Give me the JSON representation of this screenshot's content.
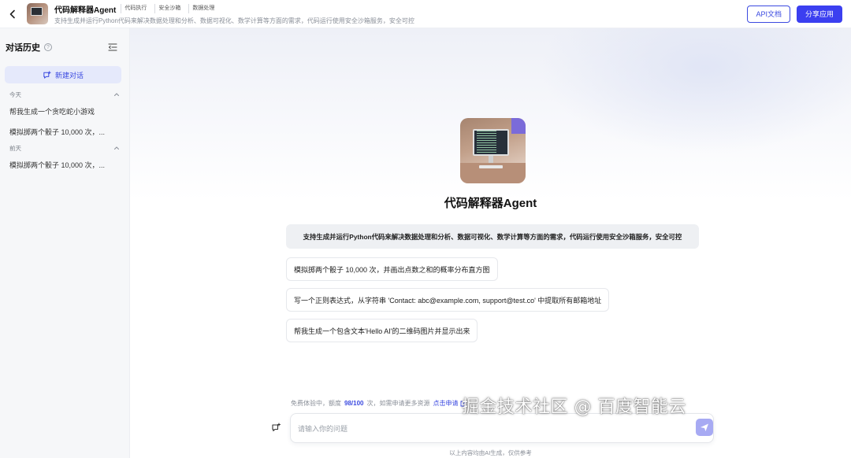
{
  "header": {
    "app_name": "代码解释器Agent",
    "tags": [
      "代码执行",
      "安全沙箱",
      "数据处理"
    ],
    "description": "支持生成并运行Python代码来解决数据处理和分析、数据可视化、数学计算等方面的需求，代码运行使用安全沙箱服务，安全可控",
    "api_doc_label": "API文档",
    "share_label": "分享应用"
  },
  "sidebar": {
    "title": "对话历史",
    "help_glyph": "?",
    "new_chat_label": "新建对话",
    "groups": [
      {
        "label": "今天",
        "items": [
          "帮我生成一个贪吃蛇小游戏",
          "模拟掷两个骰子 10,000 次，..."
        ]
      },
      {
        "label": "前天",
        "items": [
          "模拟掷两个骰子 10,000 次，..."
        ]
      }
    ]
  },
  "main": {
    "title": "代码解释器Agent",
    "intro": "支持生成并运行Python代码来解决数据处理和分析、数据可视化、数学计算等方面的需求，代码运行使用安全沙箱服务，安全可控",
    "suggestions": [
      "模拟掷两个骰子 10,000 次，并画出点数之和的概率分布直方图",
      "写一个正则表达式，从字符串 'Contact: abc@example.com, support@test.co' 中提取所有邮箱地址",
      "帮我生成一个包含文本'Hello AI'的二维码图片并显示出来"
    ],
    "quota": {
      "prefix": "免费体验中，额度",
      "value": "98/100",
      "suffix": "次，如需申请更多资源",
      "link": "点击申请"
    },
    "input_placeholder": "请输入你的问题",
    "disclaimer": "以上内容均由AI生成，仅供参考"
  },
  "watermark": "掘金技术社区 @ 百度智能云",
  "colors": {
    "accent": "#3b4ae0",
    "primary_button": "#3b3ff0",
    "sidebar_bg": "#f6f7f9",
    "new_chat_bg": "#e5e9fb"
  },
  "icons": {
    "back": "chevron-left-icon",
    "help": "question-circle-icon",
    "collapse": "sidebar-collapse-icon",
    "new_chat": "new-chat-icon",
    "group_toggle": "chevron-up-icon",
    "external": "external-link-icon",
    "clear": "clear-context-icon",
    "send": "send-icon"
  }
}
